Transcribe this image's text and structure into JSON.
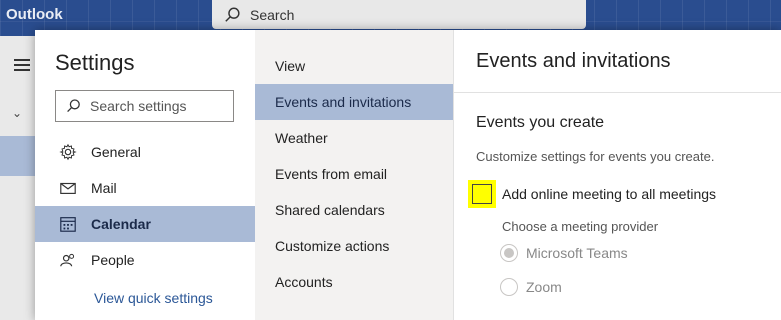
{
  "app": {
    "brand": "Outlook"
  },
  "topbar": {
    "search_label": "Search"
  },
  "settings": {
    "title": "Settings",
    "search_placeholder": "Search settings",
    "nav": [
      {
        "label": "General",
        "icon": "gear-icon",
        "selected": false
      },
      {
        "label": "Mail",
        "icon": "envelope-icon",
        "selected": false
      },
      {
        "label": "Calendar",
        "icon": "calendar-icon",
        "selected": true
      },
      {
        "label": "People",
        "icon": "people-icon",
        "selected": false
      }
    ],
    "quick_settings_link": "View quick settings"
  },
  "calendar_subnav": [
    {
      "label": "View",
      "selected": false
    },
    {
      "label": "Events and invitations",
      "selected": true
    },
    {
      "label": "Weather",
      "selected": false
    },
    {
      "label": "Events from email",
      "selected": false
    },
    {
      "label": "Shared calendars",
      "selected": false
    },
    {
      "label": "Customize actions",
      "selected": false
    },
    {
      "label": "Accounts",
      "selected": false
    }
  ],
  "panel": {
    "title": "Events and invitations",
    "section_title": "Events you create",
    "section_desc": "Customize settings for events you create.",
    "online_meeting_checkbox": {
      "label": "Add online meeting to all meetings",
      "checked": false,
      "highlight_color": "#ffff00"
    },
    "provider_label": "Choose a meeting provider",
    "providers": [
      {
        "label": "Microsoft Teams",
        "selected": true,
        "disabled": true
      },
      {
        "label": "Zoom",
        "selected": false,
        "disabled": true
      }
    ]
  },
  "colors": {
    "selected_bg": "#a9bad6",
    "topbar_bg": "#2a4d8f",
    "link": "#2b5797"
  }
}
